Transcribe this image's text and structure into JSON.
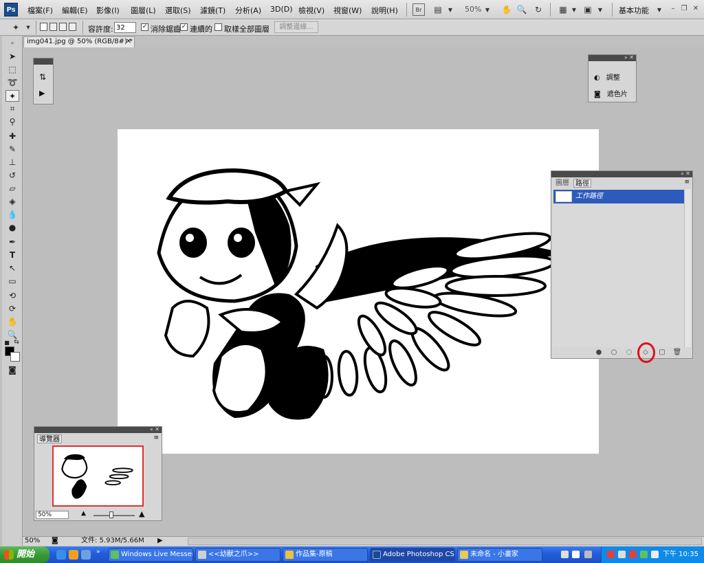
{
  "app": {
    "logo": "Ps",
    "menu": [
      "檔案(F)",
      "編輯(E)",
      "影像(I)",
      "圖層(L)",
      "選取(S)",
      "濾鏡(T)",
      "分析(A)",
      "3D(D)",
      "檢視(V)",
      "視窗(W)",
      "說明(H)"
    ],
    "zoom": "50%",
    "workspace": "基本功能"
  },
  "options": {
    "tolerance_label": "容許度:",
    "tolerance_value": "32",
    "antialias_label": "消除鋸齒",
    "antialias_checked": true,
    "contiguous_label": "連續的",
    "contiguous_checked": true,
    "sample_all_label": "取樣全部圖層",
    "sample_all_checked": false,
    "refine_label": "調整邊緣..."
  },
  "document": {
    "tab_label": "img041.jpg @ 50% (RGB/8#) *"
  },
  "adjust_panel": {
    "items": [
      {
        "label": "調整",
        "icon": "adjustments-icon"
      },
      {
        "label": "遮色片",
        "icon": "masks-icon"
      }
    ]
  },
  "paths_panel": {
    "tabs": [
      "圖層",
      "路徑"
    ],
    "active_tab": "路徑",
    "rows": [
      {
        "label": "工作路徑"
      }
    ],
    "highlight_color": "#e0101a"
  },
  "navigator": {
    "title": "導覽器",
    "zoom": "50%"
  },
  "status": {
    "zoom": "50%",
    "doc_info": "文件: 5.93M/5.66M"
  },
  "taskbar": {
    "start_label": "開始",
    "tasks": [
      {
        "label": "Windows Live Messen...",
        "active": false
      },
      {
        "label": "<<幼獸之爪>>",
        "active": false
      },
      {
        "label": "作品集-原稿",
        "active": false
      },
      {
        "label": "Adobe Photoshop CS4...",
        "active": true
      },
      {
        "label": "未命名 - 小畫家",
        "active": false
      }
    ],
    "clock": "下午 10:35"
  }
}
